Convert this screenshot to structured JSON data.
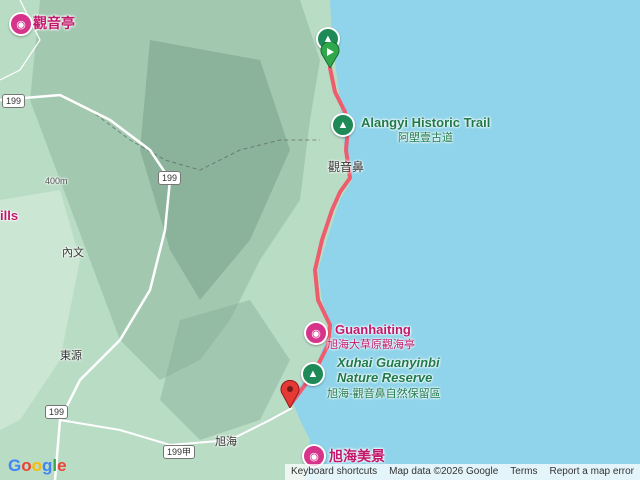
{
  "colors": {
    "sea": "#8fd4ea",
    "land": "#b9dcc5",
    "route": "#ef5c6e",
    "park": "#1e8a57",
    "attraction": "#d6338a"
  },
  "labels": {
    "guanyinting": "觀音亭",
    "alangyi_en": "Alangyi Historic Trail",
    "alangyi_zh": "阿塱壹古道",
    "guanyinbi_cape": "觀音鼻",
    "ills": "ills",
    "neiwen": "內文",
    "dongyuan": "東源",
    "guanhaiting_en": "Guanhaiting",
    "guanhaiting_zh": "旭海大草原觀海亭",
    "reserve_en_1": "Xuhai Guanyinbi",
    "reserve_en_2": "Nature Reserve",
    "reserve_zh": "旭海-觀音鼻自然保留區",
    "xuhai": "旭海",
    "xuhai_beauty": "旭海美景",
    "contour": "400m"
  },
  "roads": {
    "r199a": "199",
    "r199b": "199",
    "r199c": "199",
    "r199jia": "199甲"
  },
  "footer": {
    "shortcuts": "Keyboard shortcuts",
    "mapdata": "Map data ©2026 Google",
    "terms": "Terms",
    "report": "Report a map error"
  },
  "logo": [
    "G",
    "o",
    "o",
    "g",
    "l",
    "e"
  ],
  "icons": {
    "park": "tree-icon",
    "attraction": "camera-icon",
    "start": "green-flag-icon",
    "end": "red-pin-icon"
  }
}
